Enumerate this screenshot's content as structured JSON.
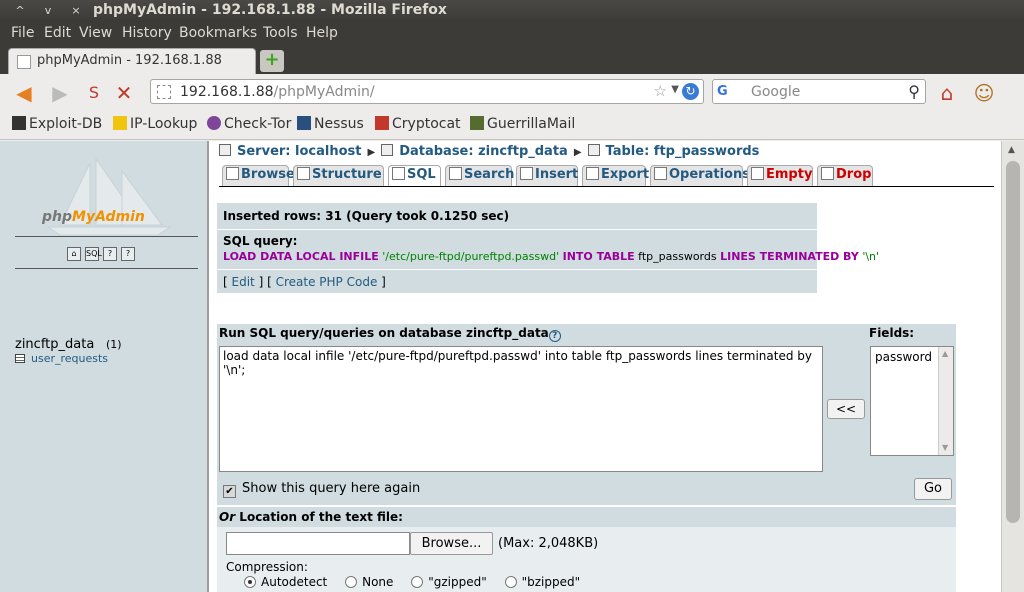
{
  "window": {
    "title": "phpMyAdmin - 192.168.1.88 - Mozilla Firefox",
    "controls": [
      "^",
      "v",
      "×"
    ]
  },
  "menu": [
    "File",
    "Edit",
    "View",
    "History",
    "Bookmarks",
    "Tools",
    "Help"
  ],
  "tab": {
    "label": "phpMyAdmin - 192.168.1.88",
    "new_tab": "+"
  },
  "nav": {
    "url_host": "192.168.1.88",
    "url_path": "/phpMyAdmin/",
    "search_engine": "G",
    "search_placeholder": "Google"
  },
  "bookmarks": [
    {
      "label": "Exploit-DB",
      "color": "#333333"
    },
    {
      "label": "IP-Lookup",
      "color": "#f1c40f"
    },
    {
      "label": "Check-Tor",
      "color": "#7d4698"
    },
    {
      "label": "Nessus",
      "color": "#2b4f7c"
    },
    {
      "label": "Cryptocat",
      "color": "#c0392b"
    },
    {
      "label": "GuerrillaMail",
      "color": "#556b2f"
    }
  ],
  "sidebar": {
    "logo_php": "php",
    "logo_my": "MyAdmin",
    "icons": [
      "home-icon",
      "sql-icon",
      "query-window-icon",
      "docs-icon"
    ],
    "database": "zincftp_data",
    "table_count": "(1)",
    "tables": [
      "user_requests"
    ]
  },
  "breadcrumb": {
    "server": "Server: localhost",
    "database": "Database: zincftp_data",
    "table": "Table: ftp_passwords"
  },
  "tabs": [
    "Browse",
    "Structure",
    "SQL",
    "Search",
    "Insert",
    "Export",
    "Operations",
    "Empty",
    "Drop"
  ],
  "message": {
    "inserted": "Inserted rows: 31 (Query took 0.1250 sec)",
    "sql_label": "SQL query:",
    "sql_kw1": "LOAD DATA LOCAL INFILE",
    "sql_str1": "'/etc/pure-ftpd/pureftpd.passwd'",
    "sql_kw2": "INTO TABLE",
    "sql_tbl": "ftp_passwords",
    "sql_kw3": "LINES TERMINATED BY",
    "sql_str2": "'\\n'",
    "edit_link": "Edit",
    "create_php_link": "Create PHP Code",
    "bracket_open": "[",
    "bracket_close": "]",
    "bracket_mid": "] ["
  },
  "query": {
    "header": "Run SQL query/queries on database zincftp_data",
    "help": "?",
    "text": "load data local infile '/etc/pure-ftpd/pureftpd.passwd' into table ftp_passwords lines terminated by '\\n';",
    "fields_label": "Fields:",
    "fields": [
      "password"
    ],
    "insert_button": "<<",
    "show_again": "Show this query here again",
    "go": "Go"
  },
  "location": {
    "or": "Or",
    "header": " Location of the text file:",
    "browse": "Browse...",
    "max": "(Max: 2,048KB)",
    "compression_label": "Compression:",
    "options": [
      "Autodetect",
      "None",
      "\"gzipped\"",
      "\"bzipped\""
    ],
    "selected": "Autodetect"
  }
}
